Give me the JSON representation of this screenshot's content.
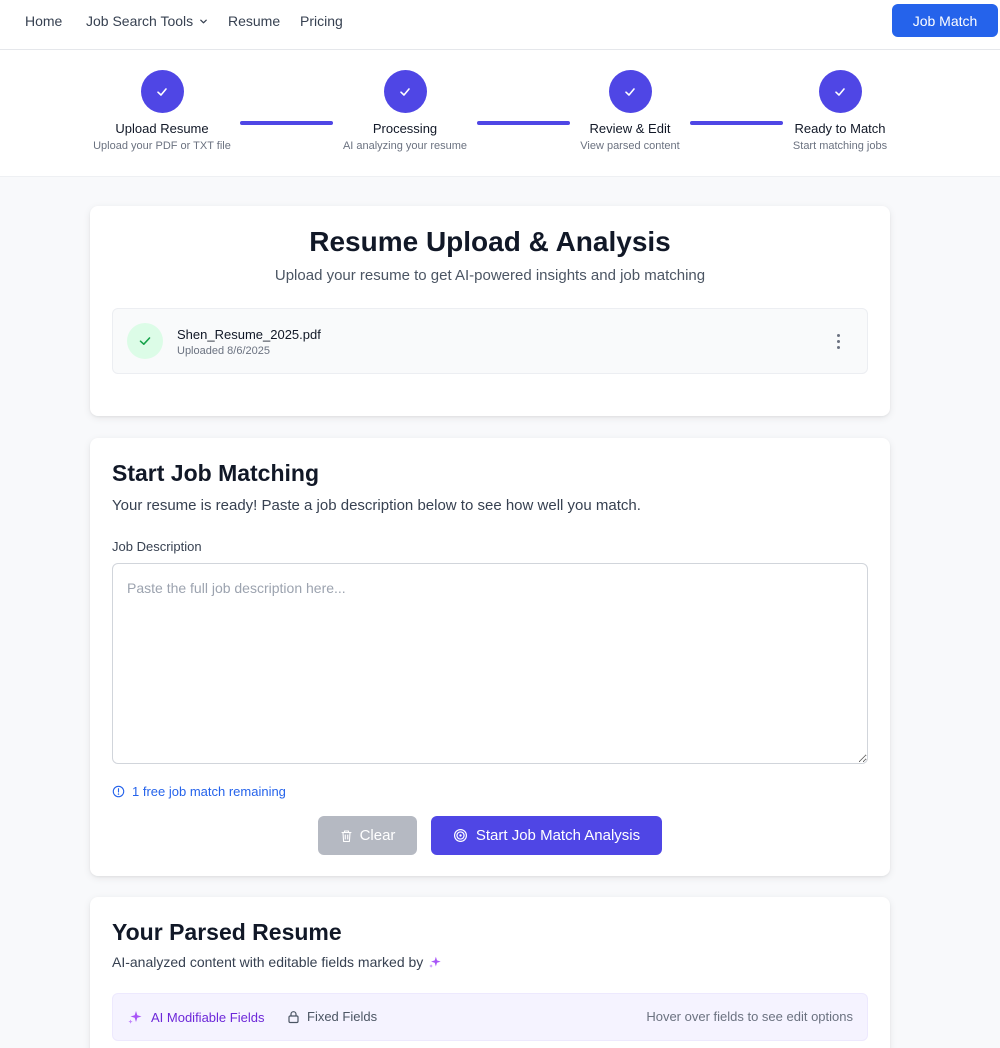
{
  "nav": {
    "home": "Home",
    "job_search_tools": "Job Search Tools",
    "resume": "Resume",
    "pricing": "Pricing",
    "job_match_button": "Job Match"
  },
  "stepper": {
    "steps": [
      {
        "title": "Upload Resume",
        "subtitle": "Upload your PDF or TXT file"
      },
      {
        "title": "Processing",
        "subtitle": "AI analyzing your resume"
      },
      {
        "title": "Review & Edit",
        "subtitle": "View parsed content"
      },
      {
        "title": "Ready to Match",
        "subtitle": "Start matching jobs"
      }
    ]
  },
  "upload": {
    "title": "Resume Upload & Analysis",
    "subtitle": "Upload your resume to get AI-powered insights and job matching",
    "file_name": "Shen_Resume_2025.pdf",
    "file_date": "Uploaded 8/6/2025"
  },
  "matching": {
    "title": "Start Job Matching",
    "subtitle": "Your resume is ready! Paste a job description below to see how well you match.",
    "field_label": "Job Description",
    "placeholder": "Paste the full job description here...",
    "remaining": "1 free job match remaining",
    "clear_label": "Clear",
    "start_label": "Start Job Match Analysis"
  },
  "parsed": {
    "title": "Your Parsed Resume",
    "subtitle": "AI-analyzed content with editable fields marked by",
    "legend_ai": "AI Modifiable Fields",
    "legend_fixed": "Fixed Fields",
    "legend_hint": "Hover over fields to see edit options"
  },
  "colors": {
    "accent": "#4f46e5",
    "primary_button": "#2563eb",
    "success_bg": "#dcfce7",
    "success": "#16a34a",
    "ai_purple": "#a855f7"
  }
}
